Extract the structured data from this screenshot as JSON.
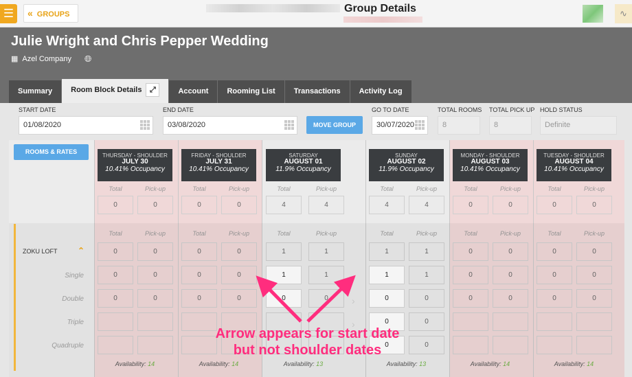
{
  "topbar": {
    "title": "Group Details",
    "back_label": "GROUPS",
    "menu_icon": "hamburger-icon",
    "back_icon": "double-chevron-left-icon",
    "right_icon": "chart-icon",
    "accent": "#f0a820"
  },
  "group": {
    "title": "Julie Wright and Chris Pepper Wedding",
    "company": "Azel Company"
  },
  "tabs": [
    {
      "label": "Summary"
    },
    {
      "label": "Room Block Details",
      "active": true
    },
    {
      "label": "Account"
    },
    {
      "label": "Rooming List"
    },
    {
      "label": "Transactions"
    },
    {
      "label": "Activity Log"
    }
  ],
  "fields": {
    "start_date": {
      "label": "START DATE",
      "value": "01/08/2020"
    },
    "end_date": {
      "label": "END DATE",
      "value": "03/08/2020"
    },
    "move_group": "MOVE GROUP",
    "go_to_date": {
      "label": "GO TO DATE",
      "value": "30/07/2020"
    },
    "total_rooms": {
      "label": "TOTAL ROOMS",
      "value": "8"
    },
    "total_pickup": {
      "label": "TOTAL PICK UP",
      "value": "8"
    },
    "hold_status": {
      "label": "HOLD STATUS",
      "placeholder": "Definite"
    }
  },
  "rooms_rates_label": "ROOMS & RATES",
  "labels": {
    "total": "Total",
    "pickup": "Pick-up"
  },
  "room_type": "ZOKU LOFT",
  "room_rows": [
    "Single",
    "Double",
    "Triple",
    "Quadruple"
  ],
  "days": [
    {
      "name": "THURSDAY - SHOULDER",
      "date": "JULY 30",
      "occupancy": "10.41% Occupancy",
      "shoulder": true,
      "top": [
        "0",
        "0"
      ],
      "zoku": [
        "0",
        "0"
      ],
      "rows": [
        [
          "0",
          "0"
        ],
        [
          "0",
          "0"
        ],
        [
          "",
          ""
        ],
        [
          "",
          ""
        ]
      ],
      "availability": "14"
    },
    {
      "name": "FRIDAY - SHOULDER",
      "date": "JULY 31",
      "occupancy": "10.41% Occupancy",
      "shoulder": true,
      "top": [
        "0",
        "0"
      ],
      "zoku": [
        "0",
        "0"
      ],
      "rows": [
        [
          "0",
          "0"
        ],
        [
          "0",
          "0"
        ],
        [
          "",
          ""
        ],
        [
          "",
          ""
        ]
      ],
      "availability": "14"
    },
    {
      "name": "SATURDAY",
      "date": "AUGUST 01",
      "occupancy": "11.9% Occupancy",
      "shoulder": false,
      "top": [
        "4",
        "4"
      ],
      "zoku": [
        "1",
        "1"
      ],
      "rows": [
        [
          "1",
          "1"
        ],
        [
          "0",
          "0"
        ],
        [
          "",
          ""
        ],
        [
          "",
          ""
        ]
      ],
      "availability": "13"
    },
    {
      "name": "SUNDAY",
      "date": "AUGUST 02",
      "occupancy": "11.9% Occupancy",
      "shoulder": false,
      "top": [
        "4",
        "4"
      ],
      "zoku": [
        "1",
        "1"
      ],
      "rows": [
        [
          "1",
          "1"
        ],
        [
          "0",
          "0"
        ],
        [
          "0",
          "0"
        ],
        [
          "0",
          "0"
        ]
      ],
      "availability": "13"
    },
    {
      "name": "MONDAY - SHOULDER",
      "date": "AUGUST 03",
      "occupancy": "10.41% Occupancy",
      "shoulder": true,
      "top": [
        "0",
        "0"
      ],
      "zoku": [
        "0",
        "0"
      ],
      "rows": [
        [
          "0",
          "0"
        ],
        [
          "0",
          "0"
        ],
        [
          "",
          ""
        ],
        [
          "",
          ""
        ]
      ],
      "availability": "14"
    },
    {
      "name": "TUESDAY - SHOULDER",
      "date": "AUGUST 04",
      "occupancy": "10.41% Occupancy",
      "shoulder": true,
      "top": [
        "0",
        "0"
      ],
      "zoku": [
        "0",
        "0"
      ],
      "rows": [
        [
          "0",
          "0"
        ],
        [
          "0",
          "0"
        ],
        [
          "",
          ""
        ],
        [
          "",
          ""
        ]
      ],
      "availability": "14"
    }
  ],
  "availability_label": "Availability:",
  "annotation": {
    "line1": "Arrow appears for start date",
    "line2": "but not shoulder dates",
    "color": "#ff2d7e"
  }
}
